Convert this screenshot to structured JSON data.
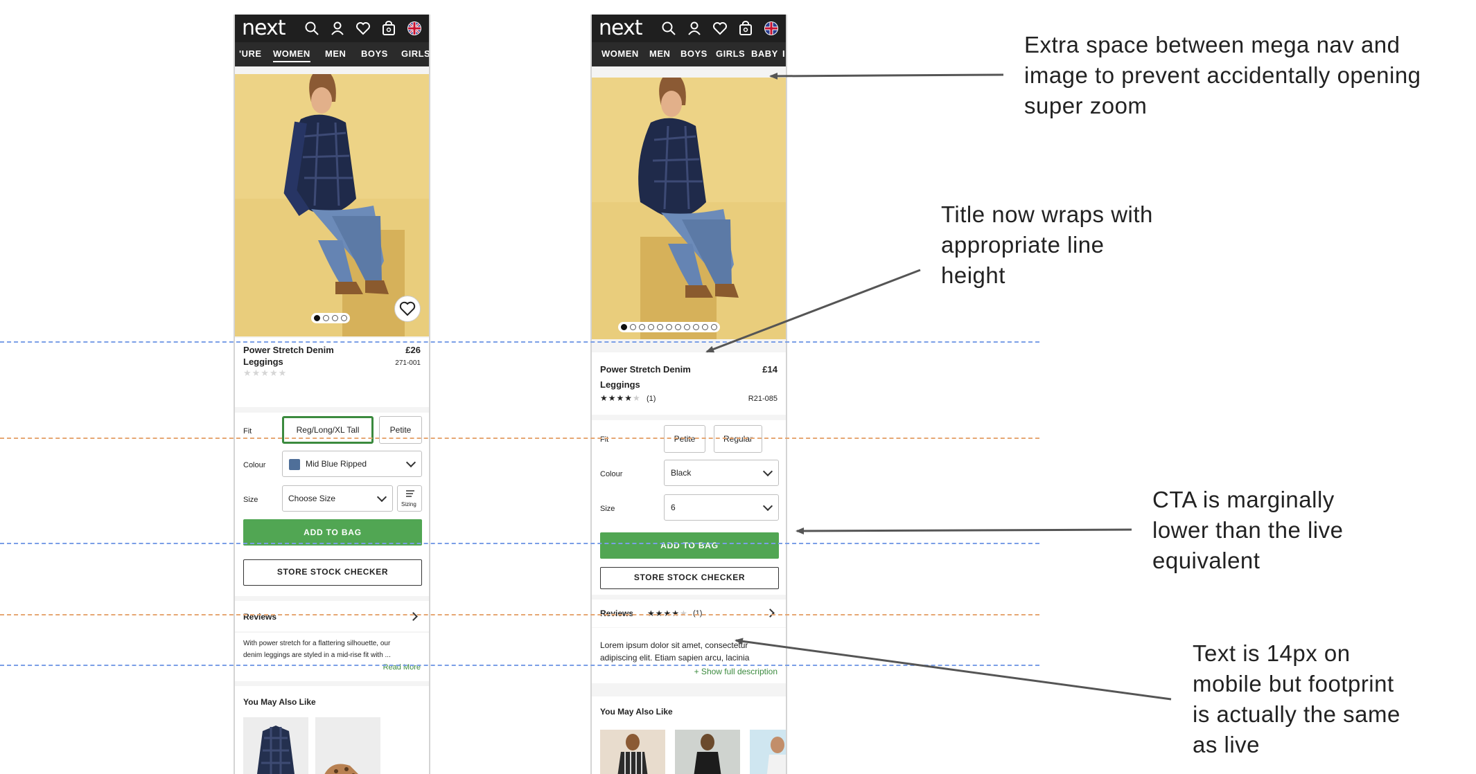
{
  "phone_a": {
    "brand": "next",
    "nav": [
      "'URE",
      "WOMEN",
      "MEN",
      "BOYS",
      "GIRLS"
    ],
    "product": {
      "title_line1": "Power Stretch Denim",
      "title_line2": "Leggings",
      "price": "£26",
      "code": "271-001",
      "rating": 0
    },
    "fit_label": "Fit",
    "fit_options": [
      "Reg/Long/XL Tall",
      "Petite"
    ],
    "colour_label": "Colour",
    "colour_value": "Mid Blue Ripped",
    "colour_swatch": "#4f6f99",
    "size_label": "Size",
    "size_value": "Choose Size",
    "sizing_label": "Sizing",
    "add_to_bag": "ADD TO BAG",
    "store_stock": "STORE STOCK CHECKER",
    "reviews_label": "Reviews",
    "desc_line1": "With power stretch for a flattering silhouette, our",
    "desc_line2": "denim leggings are styled in a mid-rise fit with ...",
    "read_more": "Read More",
    "ymal": "You May Also Like",
    "image_dots": 4
  },
  "phone_b": {
    "brand": "next",
    "nav": [
      "WOMEN",
      "MEN",
      "BOYS",
      "GIRLS",
      "BABY",
      "I"
    ],
    "product": {
      "title_line1": "Power Stretch Denim",
      "title_line2": "Leggings",
      "price": "£14",
      "code": "R21-085",
      "rating": 4,
      "review_count": "(1)"
    },
    "fit_label": "Fit",
    "fit_options": [
      "Petite",
      "Regular"
    ],
    "colour_label": "Colour",
    "colour_value": "Black",
    "size_label": "Size",
    "size_value": "6",
    "add_to_bag": "ADD TO BAG",
    "store_stock": "STORE STOCK CHECKER",
    "reviews_label": "Reviews",
    "review_count": "(1)",
    "desc_line1": "Lorem ipsum dolor sit amet, consectetur",
    "desc_line2": "adipiscing elit. Etiam sapien arcu, lacinia",
    "show_full": "+ Show full description",
    "ymal": "You May Also Like",
    "image_dots": 11
  },
  "annotations": {
    "a1": [
      "Extra space between mega nav and",
      "image to prevent accidentally opening",
      "super zoom"
    ],
    "a2": [
      "Title now wraps with",
      "appropriate line",
      "height"
    ],
    "a3": [
      "CTA is marginally",
      "lower than the live",
      "equivalent"
    ],
    "a4": [
      "Text is 14px on",
      "mobile but footprint",
      "is actually the same",
      "as live"
    ]
  },
  "colors": {
    "accent_green": "#51a653",
    "nav_dark": "#1f1f1f",
    "guide_blue": "#7a9ee6",
    "guide_orange": "#e6a672",
    "photo_bg": "#e7c977"
  }
}
